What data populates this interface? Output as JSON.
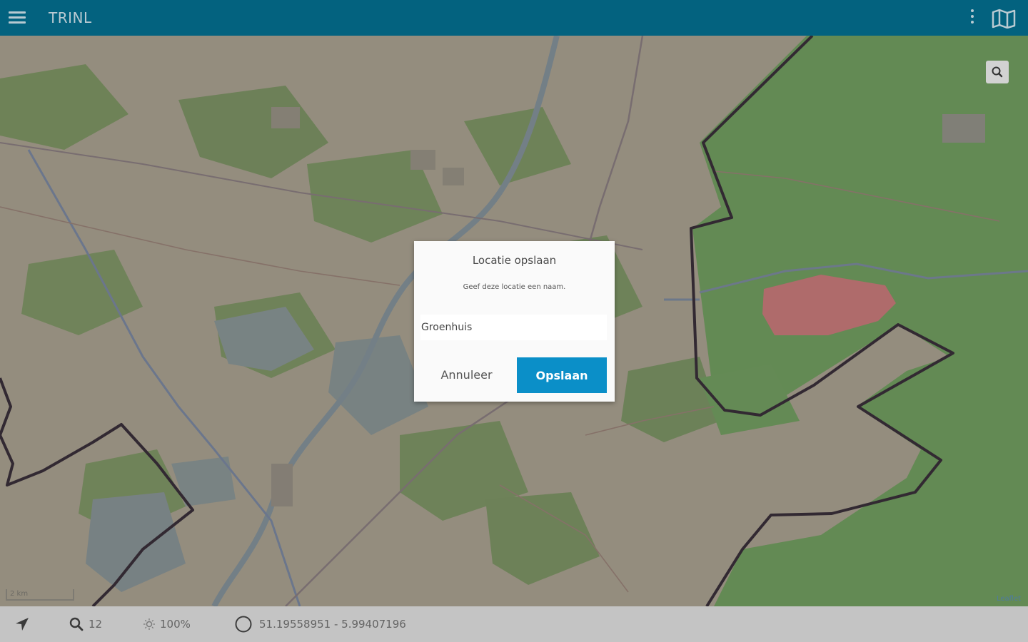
{
  "app": {
    "title": "TRINL"
  },
  "colors": {
    "appbar": "#03627f",
    "accent": "#0b8fc8",
    "forest": "#6fa55a",
    "military_zone": "#d97a7a",
    "border": "#2b1f2b"
  },
  "map": {
    "scale_label": "2 km",
    "attribution": "Leaflet"
  },
  "statusbar": {
    "zoom": "12",
    "brightness": "100%",
    "coordinates": "51.19558951 - 5.99407196"
  },
  "dialog": {
    "title": "Locatie opslaan",
    "message": "Geef deze locatie een naam.",
    "input_value": "Groenhuis",
    "cancel_label": "Annuleer",
    "save_label": "Opslaan"
  }
}
